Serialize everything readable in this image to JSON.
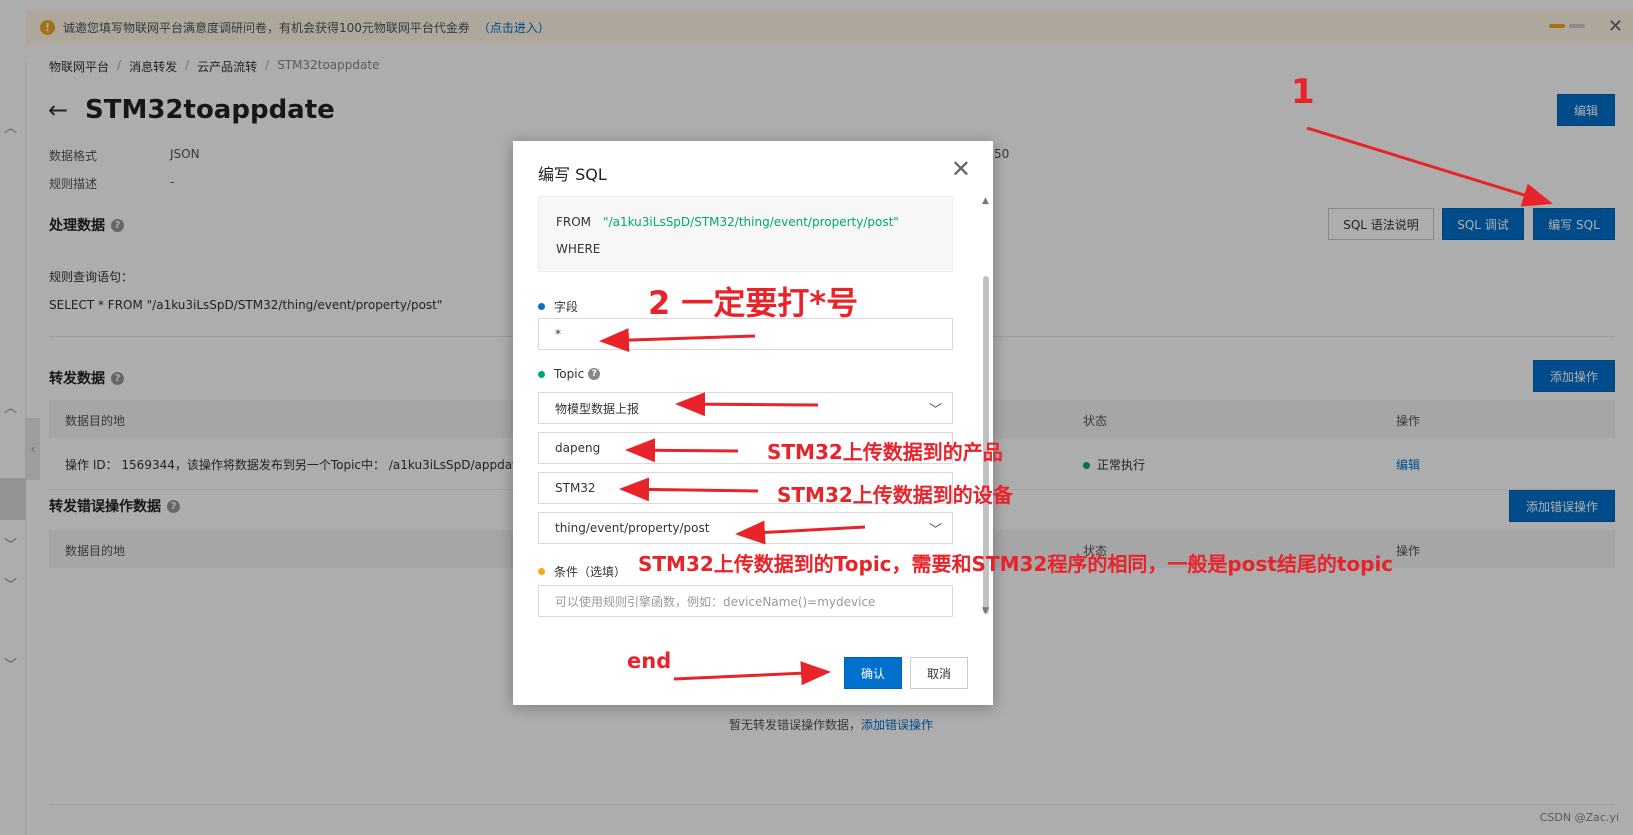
{
  "notice": {
    "text": "诚邀您填写物联网平台满意度调研问卷，有机会获得100元物联网平台代金券",
    "link": "（点击进入）"
  },
  "breadcrumb": [
    "物联网平台",
    "消息转发",
    "云产品流转",
    "STM32toappdate"
  ],
  "page": {
    "title": "STM32toappdate",
    "edit_button": "编辑",
    "data_format_label": "数据格式",
    "data_format_value": "JSON",
    "rule_desc_label": "规则描述",
    "rule_desc_value": "-",
    "partial_value": "50"
  },
  "process": {
    "title": "处理数据",
    "sql_doc_button": "SQL 语法说明",
    "sql_debug_button": "SQL 调试",
    "edit_sql_button": "编写 SQL",
    "query_label": "规则查询语句：",
    "query_value": "SELECT * FROM \"/a1ku3iLsSpD/STM32/thing/event/property/post\""
  },
  "forward": {
    "title": "转发数据",
    "add_button": "添加操作",
    "columns": [
      "数据目的地",
      "状态",
      "操作"
    ],
    "row": {
      "destination": "操作 ID： 1569344，该操作将数据发布到另一个Topic中： /a1ku3iLsSpD/appdata/us",
      "status": "正常执行",
      "action": "编辑"
    }
  },
  "forward_error": {
    "title": "转发错误操作数据",
    "add_button": "添加错误操作",
    "columns": [
      "数据目的地",
      "状态",
      "操作"
    ],
    "empty_text": "暂无转发错误操作数据，",
    "empty_link": "添加错误操作"
  },
  "modal": {
    "title": "编写 SQL",
    "sql_from_keyword": "FROM",
    "sql_from_topic": "\"/a1ku3iLsSpD/STM32/thing/event/property/post\"",
    "sql_where_keyword": "WHERE",
    "field_label": "字段",
    "field_value": "*",
    "topic_label": "Topic",
    "topic_type": "物模型数据上报",
    "topic_product": "dapeng",
    "topic_device": "STM32",
    "topic_path": "thing/event/property/post",
    "condition_label": "条件（选填）",
    "condition_placeholder": "可以使用规则引擎函数，例如：deviceName()=mydevice",
    "confirm_button": "确认",
    "cancel_button": "取消"
  },
  "annotations": {
    "step1": "1",
    "step2": "2  一定要打*号",
    "product_note": "STM32上传数据到的产品",
    "device_note": "STM32上传数据到的设备",
    "topic_note": "STM32上传数据到的Topic，需要和STM32程序的相同，一般是post结尾的topic",
    "end_note": "end"
  },
  "watermark": "CSDN @Zac.yi",
  "colors": {
    "primary": "#0070cc",
    "annotation": "#e8232a",
    "status_ok": "#00a870",
    "notice_bg": "#fff7e6"
  }
}
